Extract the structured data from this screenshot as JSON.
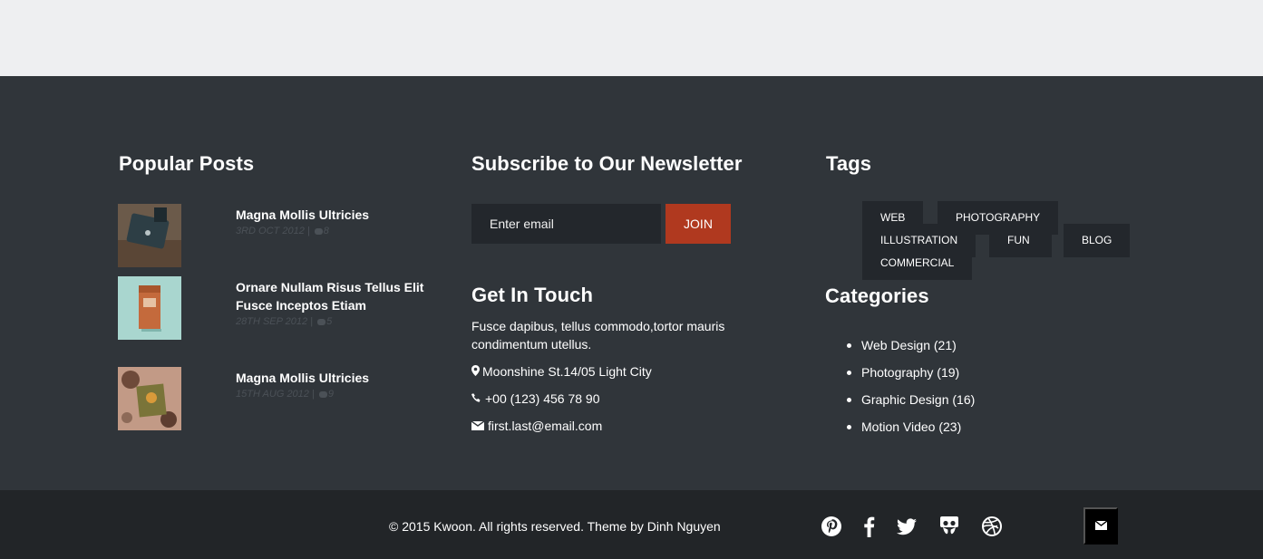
{
  "popular_posts": {
    "title": "Popular Posts",
    "items": [
      {
        "title": "Magna Mollis Ultricies",
        "date": "3RD OCT 2012",
        "comments": "8"
      },
      {
        "title": "Ornare Nullam Risus Tellus Elit Fusce Inceptos Etiam",
        "date": "28TH SEP 2012",
        "comments": "5"
      },
      {
        "title": "Magna Mollis Ultricies",
        "date": "15TH AUG 2012",
        "comments": "9"
      }
    ]
  },
  "newsletter": {
    "title": "Subscribe to Our Newsletter",
    "placeholder": "Enter email",
    "button": "JOIN"
  },
  "contact": {
    "title": "Get In Touch",
    "description": "Fusce dapibus, tellus commodo,tortor mauris condimentum utellus.",
    "address": "Moonshine St.14/05 Light City",
    "phone": "+00 (123) 456 78 90",
    "email": "first.last@email.com"
  },
  "tags": {
    "title": "Tags",
    "items": [
      "WEB",
      "PHOTOGRAPHY",
      "ILLUSTRATION",
      "FUN",
      "BLOG",
      "COMMERCIAL"
    ]
  },
  "categories": {
    "title": "Categories",
    "items": [
      {
        "label": "Web Design (21)"
      },
      {
        "label": "Photography (19)"
      },
      {
        "label": "Graphic Design (16)"
      },
      {
        "label": "Motion Video (23)"
      }
    ]
  },
  "bottom_bar": {
    "copyright": "© 2015 Kwoon. All rights reserved. Theme by Dinh Nguyen",
    "social_icons": [
      "pinterest-icon",
      "facebook-icon",
      "twitter-icon",
      "slideshare-icon",
      "dribbble-icon"
    ],
    "mail_icon": "envelope-icon"
  },
  "colors": {
    "footer_bg": "#30353a",
    "bottom_bg": "#222528",
    "accent": "#b0391f",
    "input_bg": "#23272c",
    "meta_text": "#4b5157"
  }
}
